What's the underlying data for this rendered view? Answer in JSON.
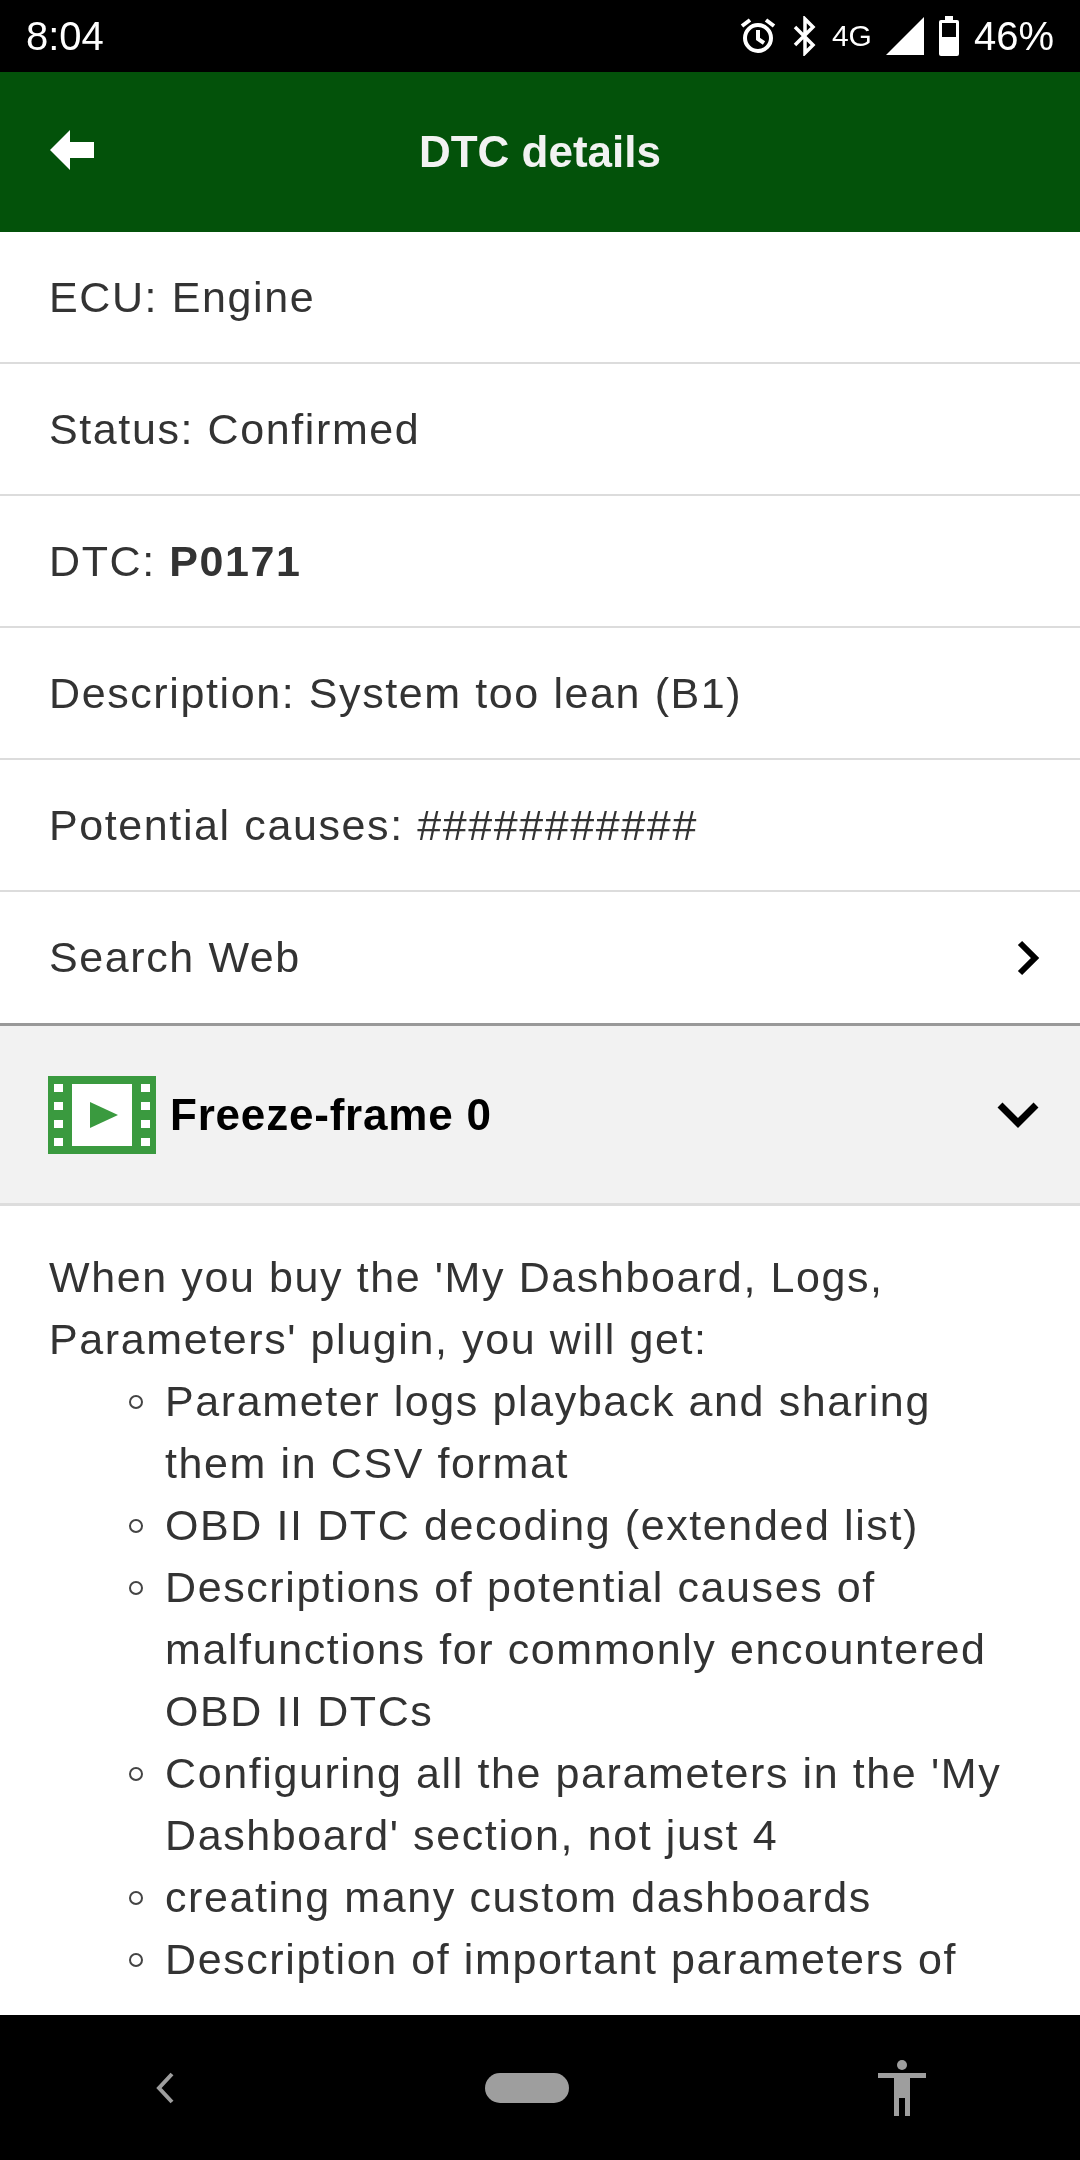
{
  "status_bar": {
    "time": "8:04",
    "network": "4G",
    "battery": "46%"
  },
  "app_bar": {
    "title": "DTC details"
  },
  "details": [
    {
      "kind": "plain",
      "label": "ECU: ",
      "value": "Engine"
    },
    {
      "kind": "plain",
      "label": "Status: ",
      "value": "Confirmed"
    },
    {
      "kind": "bold",
      "label": "DTC: ",
      "value": "P0171"
    },
    {
      "kind": "plain",
      "label": "Description: ",
      "value": "System too lean (B1)"
    },
    {
      "kind": "plain",
      "label": "Potential causes: ",
      "value": "###########"
    },
    {
      "kind": "link",
      "label": "Search Web"
    }
  ],
  "freeze_frame": {
    "title": "Freeze-frame 0",
    "expanded": true
  },
  "promo": {
    "intro": "When you buy the 'My Dashboard, Logs, Parameters' plugin, you will get:",
    "items": [
      "Parameter logs playback and sharing them in CSV format",
      "OBD II DTC decoding (extended list)",
      "Descriptions of potential causes of malfunctions for commonly encountered OBD II DTCs",
      "Configuring all the parameters in the 'My Dashboard' section, not just 4",
      "creating many custom dashboards",
      "Description of important parameters of"
    ]
  }
}
